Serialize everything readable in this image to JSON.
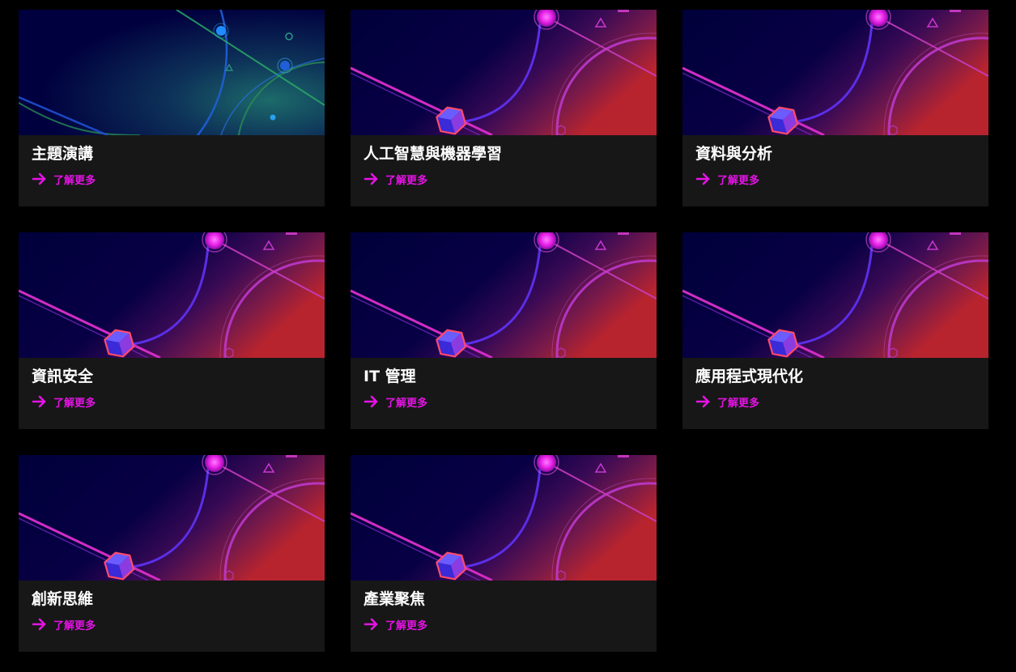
{
  "cards": [
    {
      "title": "主題演講",
      "link": "了解更多",
      "image": "network-nodes-teal"
    },
    {
      "title": "人工智慧與機器學習",
      "link": "了解更多",
      "image": "neon-cube-orbit"
    },
    {
      "title": "資料與分析",
      "link": "了解更多",
      "image": "neon-cube-orbit"
    },
    {
      "title": "資訊安全",
      "link": "了解更多",
      "image": "neon-cube-orbit"
    },
    {
      "title": "IT 管理",
      "link": "了解更多",
      "image": "neon-cube-orbit"
    },
    {
      "title": "應用程式現代化",
      "link": "了解更多",
      "image": "neon-cube-orbit"
    },
    {
      "title": "創新思維",
      "link": "了解更多",
      "image": "neon-cube-orbit"
    },
    {
      "title": "產業聚焦",
      "link": "了解更多",
      "image": "neon-cube-orbit"
    }
  ],
  "icons": {
    "link_icon": "arrow-right-icon"
  },
  "colors": {
    "page_background": "#000000",
    "card_background": "#171717",
    "title_text": "#ffffff",
    "link_accent": "#e513e5",
    "image_navy": "#00003c",
    "image_red": "#c0222a"
  }
}
